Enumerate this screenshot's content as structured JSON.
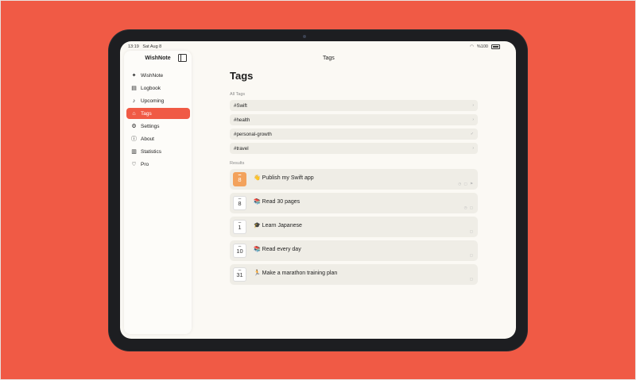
{
  "statusbar": {
    "time": "13:19",
    "date": "Sat Aug 8",
    "battery": "%100"
  },
  "sidebar": {
    "title": "WishNote",
    "items": [
      {
        "label": "WishNote",
        "icon": "sparkle-icon",
        "glyph": "✦"
      },
      {
        "label": "Logbook",
        "icon": "archive-icon",
        "glyph": "▤"
      },
      {
        "label": "Upcoming",
        "icon": "bell-icon",
        "glyph": "♪"
      },
      {
        "label": "Tags",
        "icon": "tag-icon",
        "glyph": "⌂",
        "active": true
      },
      {
        "label": "Settings",
        "icon": "gear-icon",
        "glyph": "⚙"
      },
      {
        "label": "About",
        "icon": "info-icon",
        "glyph": "ⓘ"
      },
      {
        "label": "Statistics",
        "icon": "chart-icon",
        "glyph": "▥"
      },
      {
        "label": "Pro",
        "icon": "heart-icon",
        "glyph": "♡"
      }
    ]
  },
  "nav": {
    "title": "Tags"
  },
  "main": {
    "heading": "Tags",
    "all_tags_label": "All Tags",
    "tags": [
      "#Swift",
      "#health",
      "#personal-growth",
      "#travel"
    ],
    "results_label": "Results",
    "results": [
      {
        "day": "8",
        "emoji": "👋",
        "title": "Publish my Swift app",
        "highlight": true
      },
      {
        "day": "8",
        "emoji": "📚",
        "title": "Read 30 pages"
      },
      {
        "day": "1",
        "emoji": "🎓",
        "title": "Learn Japanese"
      },
      {
        "day": "10",
        "emoji": "📚",
        "title": "Read every day"
      },
      {
        "day": "31",
        "emoji": "🏃",
        "title": "Make a marathon training plan"
      }
    ]
  },
  "colors": {
    "accent": "#f05a45",
    "background": "#f05a45",
    "highlight_date": "#f3a25c"
  }
}
